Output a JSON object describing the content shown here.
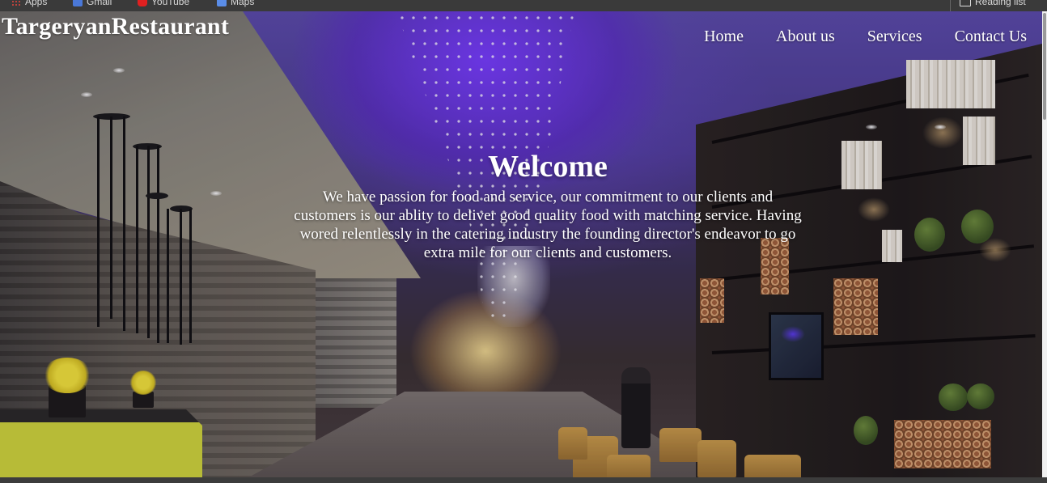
{
  "browser": {
    "bookmarks": [
      {
        "label": "Apps",
        "icon": "apps-grid-icon"
      },
      {
        "label": "Gmail",
        "icon": "gmail-icon"
      },
      {
        "label": "YouTube",
        "icon": "youtube-icon"
      },
      {
        "label": "Maps",
        "icon": "maps-icon"
      }
    ],
    "reading_list": {
      "label": "Reading list",
      "icon": "reading-list-icon"
    }
  },
  "site": {
    "brand": "TargeryanRestaurant",
    "nav": [
      {
        "label": "Home"
      },
      {
        "label": "About us"
      },
      {
        "label": "Services"
      },
      {
        "label": "Contact Us"
      }
    ]
  },
  "hero": {
    "heading": "Welcome",
    "body": "We have passion for food and service, our commitment to our clients and customers is our ablity to deliver good quality food with matching service. Having wored relentlessly in the catering industry the founding director's endeavor to go extra mile for our clients and customers.",
    "image_description_icon": "restaurant-lobby-image"
  },
  "colors": {
    "text": "#ffffff",
    "ceiling_purple": "#6a3cf0",
    "page_chrome": "#3a3a3a"
  }
}
